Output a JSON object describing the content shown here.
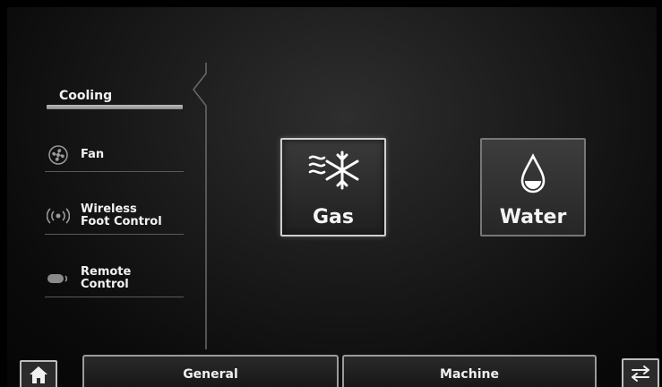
{
  "sidebar": {
    "items": [
      {
        "label": "Cooling",
        "active": true
      },
      {
        "label": "Fan",
        "icon": "fan-icon"
      },
      {
        "label": "Wireless\nFoot Control",
        "icon": "wireless-signal-icon"
      },
      {
        "label": "Remote\nControl",
        "icon": "remote-control-icon"
      }
    ]
  },
  "main": {
    "options": [
      {
        "label": "Gas",
        "icon": "snowflake-wind-icon",
        "selected": true
      },
      {
        "label": "Water",
        "icon": "water-drop-icon",
        "selected": false
      }
    ]
  },
  "bottom_bar": {
    "home_icon": "home-icon",
    "tabs": [
      {
        "label": "General"
      },
      {
        "label": "Machine"
      }
    ],
    "swap_icon": "swap-arrows-icon"
  }
}
